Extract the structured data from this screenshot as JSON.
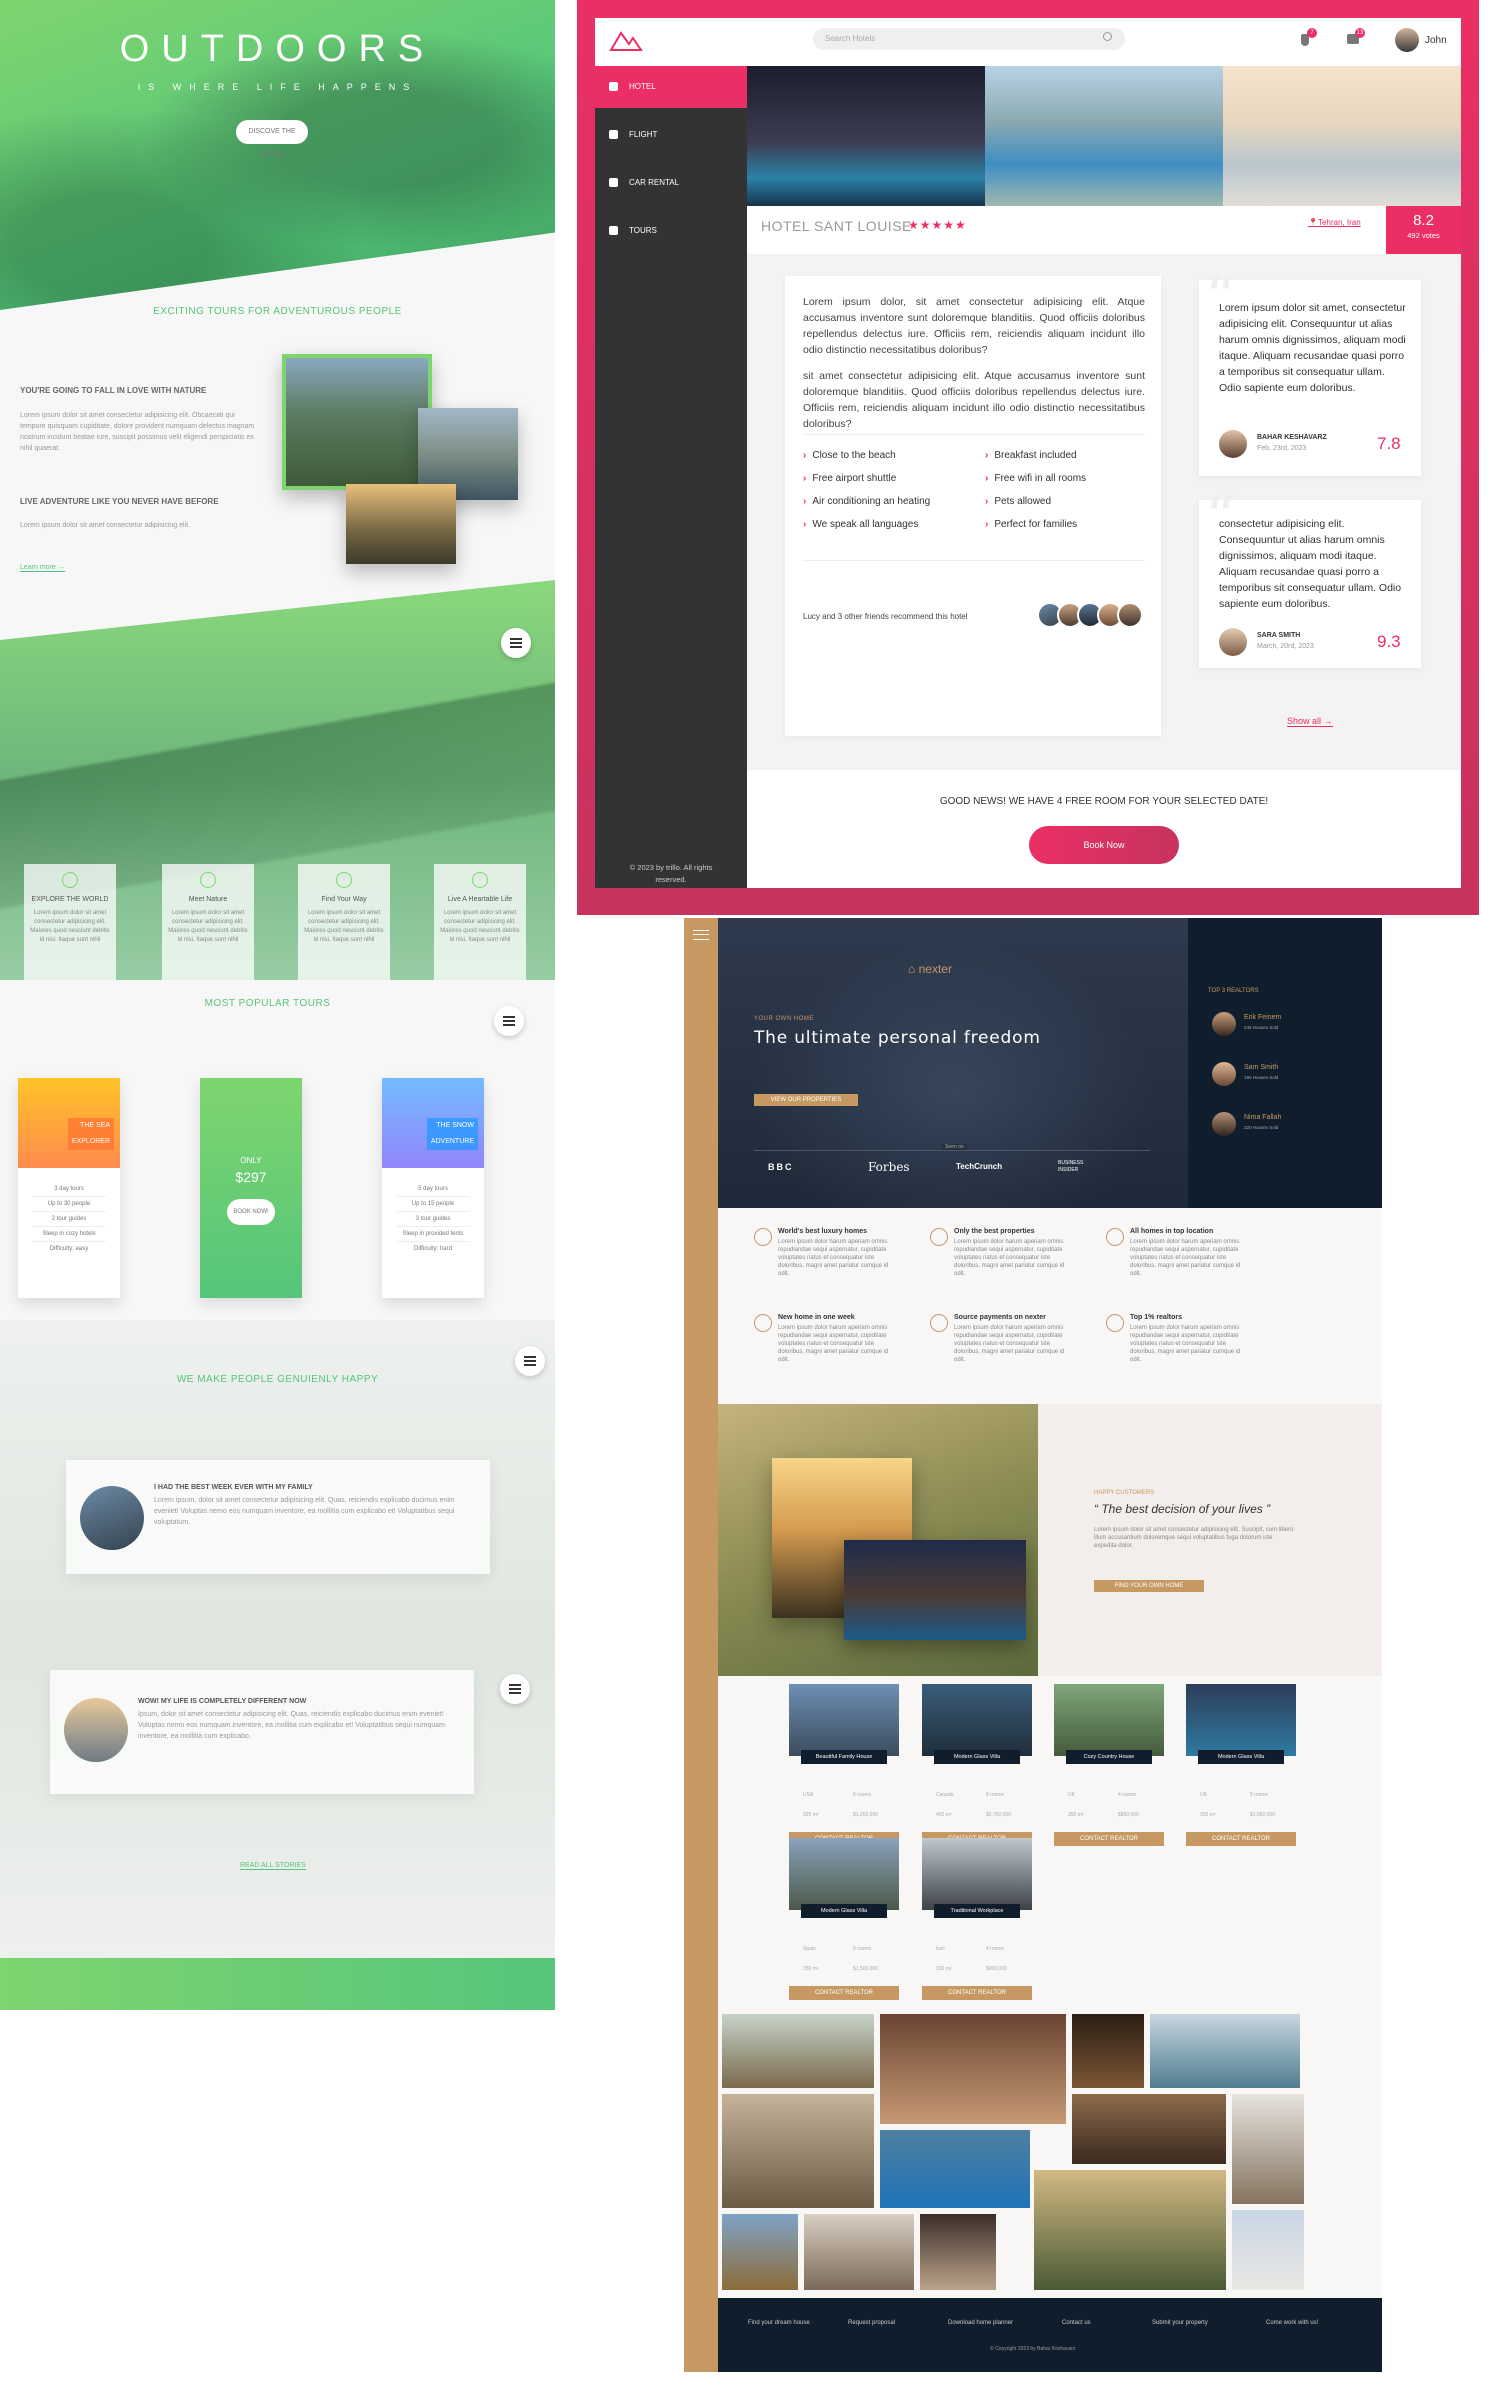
{
  "natours": {
    "hero": {
      "title": "OUTDOORS",
      "subtitle": "IS WHERE LIFE HAPPENS",
      "cta": "DISCOVE THE TOURS"
    },
    "about": {
      "heading": "EXCITING TOURS FOR ADVENTUROUS PEOPLE",
      "h1": "YOU'RE GOING TO FALL IN LOVE WITH NATURE",
      "p1": "Lorem ipsum dolor sit amet consectetur adipisicing elit. Obcaecati qui tempore quisquam cupiditate, dolore provident numquam delectus magnam nostrum incidunt beatae iure, suscipit possimus velit eligendi perspiciatis ex nihil quaerat.",
      "h2": "LIVE ADVENTURE LIKE YOU NEVER HAVE BEFORE",
      "p2": "Lorem ipsum dolor sit amet consectetur adipisicing elit.",
      "link": "Learn more →"
    },
    "features": [
      {
        "title": "EXPLORE THE WORLD",
        "text": "Lorem ipsum dolor sit amet consectetur adipisicing elit. Maiores quod nesciunt debitis id nisi. Itaque sunt nihil"
      },
      {
        "title": "Meet Nature",
        "text": "Lorem ipsum dolor sit amet consectetur adipisicing elit. Maiores quod nesciunt debitis id nisi. Itaque sunt nihil"
      },
      {
        "title": "Find Your Way",
        "text": "Lorem ipsum dolor sit amet consectetur adipisicing elit. Maiores quod nesciunt debitis id nisi. Itaque sunt nihil"
      },
      {
        "title": "Live A Heartable Life",
        "text": "Lorem ipsum dolor sit amet consectetur adipisicing elit. Maiores quod nesciunt debitis id nisi. Itaque sunt nihil"
      }
    ],
    "tours": {
      "heading": "MOST POPULAR TOURS",
      "cards": [
        {
          "tag1": "THE SEA",
          "tag2": "EXPLORER",
          "rows": [
            "3 day tours",
            "Up to 30 people",
            "2 tour guides",
            "Sleep in cozy hotels",
            "Difficulty: easy"
          ]
        },
        {
          "only": "ONLY",
          "price": "$297",
          "button": "BOOK NOW!"
        },
        {
          "tag1": "THE SNOW",
          "tag2": "ADVENTURE",
          "rows": [
            "5 day tours",
            "Up to 15 people",
            "3 tour guides",
            "Sleep in provided tents",
            "Difficulty: hard"
          ]
        }
      ]
    },
    "stories": {
      "heading": "WE MAKE PEOPLE GENUIENLY HAPPY",
      "items": [
        {
          "title": "I HAD THE BEST WEEK EVER WITH MY FAMILY",
          "text": "Lorem ipsum, dolor sit amet consectetur adipisicing elit. Quas, reiciendis explicabo ducimus enim eveniet! Voluptas nemo eos numquam inventore, ea mollitia cum explicabo et! Voluptatibus sequi voluptatum."
        },
        {
          "title": "WOW! MY LIFE IS COMPLETELY DIFFERENT NOW",
          "text": "Ipsum, dolor sit amet consectetur adipisicing elit. Quas, reiciendis explicabo ducimus enim eveniet! Voluptas nemo eos numquam inventore, ea mollitia cum explicabo et! Voluptatibus sequi numquam inventore, ea mollitia cum explicabo."
        }
      ],
      "link": "READ ALL STORIES"
    }
  },
  "trillo": {
    "search_placeholder": "Search Hotels",
    "notif_badges": [
      "7",
      "13"
    ],
    "user_name": "John",
    "nav": [
      "HOTEL",
      "FLIGHT",
      "CAR RENTAL",
      "TOURS"
    ],
    "copyright": "© 2023 by trillo. All rights reserved.",
    "hotel_name": "HOTEL SANT LOUISE",
    "stars": "★★★★★",
    "location": "Tehran, Iran",
    "rating": "8.2",
    "votes": "492 votes",
    "desc1": "Lorem ipsum dolor, sit amet consectetur adipisicing elit. Atque accusamus inventore sunt doloremque blanditiis. Quod officiis doloribus repellendus delectus iure. Officiis rem, reiciendis aliquam incidunt illo odio distinctio necessitatibus doloribus?",
    "desc2": "sit amet consectetur adipisicing elit. Atque accusamus inventore sunt doloremque blanditiis. Quod officiis doloribus repellendus delectus iure. Officiis rem, reiciendis aliquam incidunt illo odio distinctio necessitatibus doloribus?",
    "amenities": [
      "Close to the beach",
      "Breakfast included",
      "Free airport shuttle",
      "Free wifi in all rooms",
      "Air conditioning an heating",
      "Pets allowed",
      "We speak all languages",
      "Perfect for families"
    ],
    "recommend": "Lucy and 3 other friends recommend this hotel",
    "reviews": [
      {
        "text": "Lorem ipsum dolor sit amet, consectetur adipisicing elit. Consequuntur ut alias harum omnis dignissimos, aliquam modi itaque. Aliquam recusandae quasi porro a temporibus sit consequatur ullam. Odio sapiente eum doloribus.",
        "name": "BAHAR KESHAVARZ",
        "date": "Feb, 23rd, 2023",
        "score": "7.8"
      },
      {
        "text": "consectetur adipisicing elit. Consequuntur ut alias harum omnis dignissimos, aliquam modi itaque. Aliquam recusandae quasi porro a temporibus sit consequatur ullam. Odio sapiente eum doloribus.",
        "name": "SARA SMITH",
        "date": "March, 20rd, 2023",
        "score": "9.3"
      }
    ],
    "show_all": "Show all →",
    "cta_text": "GOOD NEWS! WE HAVE 4 FREE ROOM FOR YOUR SELECTED DATE!",
    "cta_button": "Book Now"
  },
  "nexter": {
    "brand": "nexter",
    "eyebrow": "YOUR OWN HOME",
    "headline": "The ultimate personal freedom",
    "hero_btn": "VIEW OUR PROPERTIES",
    "seen_on": "Seen on",
    "logos": [
      "BBC",
      "Forbes",
      "TechCrunch",
      "BUSINESS INSIDER"
    ],
    "realtors_title": "TOP 3 REALTORS",
    "realtors": [
      {
        "name": "Erik Feinem",
        "sub": "245 Houses Sold"
      },
      {
        "name": "Sam Smith",
        "sub": "190 Houses Sold"
      },
      {
        "name": "Nima Fallah",
        "sub": "220 Houses Sold"
      }
    ],
    "features": [
      {
        "title": "World's best luxury homes",
        "text": "Lorem ipsum dolor harum aperiam omnis repudiandae sequi aspernatur, cupiditate voluptates natus et consequatur iste doloribus, magni amet pariatur cumque id odit."
      },
      {
        "title": "Only the best properties",
        "text": "Lorem ipsum dolor harum aperiam omnis repudiandae sequi aspernatur, cupiditate voluptates natus et consequatur iste doloribus, magni amet pariatur cumque id odit."
      },
      {
        "title": "All homes in top location",
        "text": "Lorem ipsum dolor harum aperiam omnis repudiandae sequi aspernatur, cupiditate voluptates natus et consequatur iste doloribus, magni amet pariatur cumque id odit."
      },
      {
        "title": "New home in one week",
        "text": "Lorem ipsum dolor harum aperiam omnis repudiandae sequi aspernatur, cupiditate voluptates natus et consequatur iste doloribus, magni amet pariatur cumque id odit."
      },
      {
        "title": "Source payments on nexter",
        "text": "Lorem ipsum dolor harum aperiam omnis repudiandae sequi aspernatur, cupiditate voluptates natus et consequatur iste doloribus, magni amet pariatur cumque id odit."
      },
      {
        "title": "Top 1% realtors",
        "text": "Lorem ipsum dolor harum aperiam omnis repudiandae sequi aspernatur, cupiditate voluptates natus et consequatur iste doloribus, magni amet pariatur cumque id odit."
      }
    ],
    "story": {
      "eyebrow": "HAPPY CUSTOMERS",
      "quote": "“ The best decision of your lives ”",
      "text": "Lorem ipsum dolor sit amet consectetur adipisicing elit. Suscipit, cum libero illum accusantium doloremque sequi voluptatibus fuga dolorum iste expedita dolor.",
      "button": "FIND YOUR OWN HOME"
    },
    "homes": [
      {
        "name": "Beautiful Family House",
        "loc": "USA",
        "rooms": "5 rooms",
        "area": "325 m²",
        "price": "$1,200,000"
      },
      {
        "name": "Modern Glass Villa",
        "loc": "Canada",
        "rooms": "6 rooms",
        "area": "450 m²",
        "price": "$2,750,000"
      },
      {
        "name": "Cozy Country House",
        "loc": "UK",
        "rooms": "4 rooms",
        "area": "250 m²",
        "price": "$850,000"
      },
      {
        "name": "Modern Glass Villa",
        "loc": "UK",
        "rooms": "5 rooms",
        "area": "300 m²",
        "price": "$1,950,000"
      },
      {
        "name": "Modern Glass Villa",
        "loc": "Spain",
        "rooms": "5 rooms",
        "area": "350 m²",
        "price": "$1,500,000"
      },
      {
        "name": "Traditional Workplace",
        "loc": "Iran",
        "rooms": "4 rooms",
        "area": "300 m²",
        "price": "$900,000"
      }
    ],
    "home_cta": "CONTACT REALTOR",
    "footer": [
      "Find your dream house",
      "Request proposal",
      "Download home planner",
      "Contact us",
      "Submit your property",
      "Come work with us!"
    ],
    "copyright": "© Copyright 2023 by Bahar Keshavarz"
  }
}
